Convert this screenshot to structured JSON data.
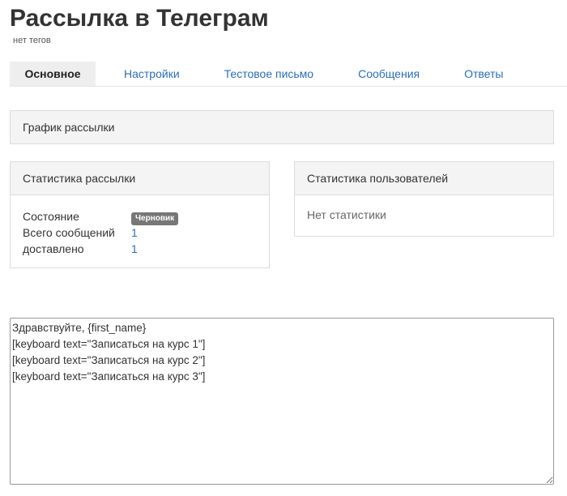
{
  "header": {
    "title": "Рассылка в Телеграм",
    "tags": "нет тегов"
  },
  "tabs": [
    {
      "label": "Основное",
      "active": true
    },
    {
      "label": "Настройки",
      "active": false
    },
    {
      "label": "Тестовое письмо",
      "active": false
    },
    {
      "label": "Сообщения",
      "active": false
    },
    {
      "label": "Ответы",
      "active": false
    }
  ],
  "schedule_panel": {
    "title": "График рассылки"
  },
  "mailing_stats": {
    "title": "Статистика рассылки",
    "state_label": "Состояние",
    "state_badge": "Черновик",
    "total_label": "Всего сообщений",
    "total_value": "1",
    "delivered_label": "доставлено",
    "delivered_value": "1"
  },
  "user_stats": {
    "title": "Статистика пользователей",
    "empty_text": "Нет статистики"
  },
  "message_editor": {
    "value": "Здравствуйте, {first_name}\n[keyboard text=\"Записаться на курс 1\"]\n[keyboard text=\"Записаться на курс 2\"]\n[keyboard text=\"Записаться на курс 3\"]"
  },
  "colors": {
    "link": "#2a6ebb",
    "badge_bg": "#777777",
    "panel_header_bg": "#f4f4f4",
    "active_tab_bg": "#eeeeee"
  }
}
